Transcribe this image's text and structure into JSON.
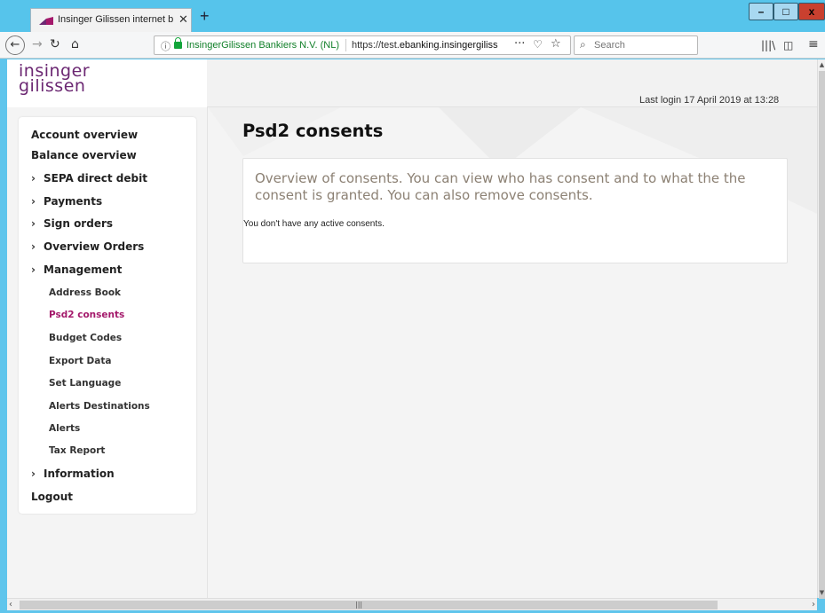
{
  "browser": {
    "tab_title": "Insinger Gilissen internet banking",
    "tab_close": "✕",
    "new_tab": "+",
    "identity": "InsingerGilissen Bankiers N.V. (NL)",
    "url_prefix": "https://test.",
    "url_host": "ebanking.insingergilissen.nl",
    "search_placeholder": "Search",
    "window_controls": {
      "minimize": "–",
      "maximize": "□",
      "close": "x"
    }
  },
  "page": {
    "logo_line1": "insinger",
    "logo_line2": "gilissen",
    "last_login": "Last login 17 April 2019  at 13:28",
    "title": "Psd2 consents",
    "intro": "Overview of consents. You can view who has consent and to what the the consent is granted. You can also remove consents.",
    "empty_message": "You don't have any active consents."
  },
  "nav": {
    "account_overview": "Account overview",
    "balance_overview": "Balance overview",
    "sepa_direct_debit": "SEPA direct debit",
    "payments": "Payments",
    "sign_orders": "Sign orders",
    "overview_orders": "Overview Orders",
    "management": "Management",
    "sub": {
      "address_book": "Address Book",
      "psd2_consents": "Psd2 consents",
      "budget_codes": "Budget Codes",
      "export_data": "Export Data",
      "set_language": "Set Language",
      "alerts_destinations": "Alerts Destinations",
      "alerts": "Alerts",
      "tax_report": "Tax Report"
    },
    "information": "Information",
    "logout": "Logout"
  },
  "colors": {
    "brand_purple": "#6b2772",
    "active_link": "#a4196b",
    "intro_text": "#8c8174",
    "chrome_blue": "#56c4eb"
  }
}
